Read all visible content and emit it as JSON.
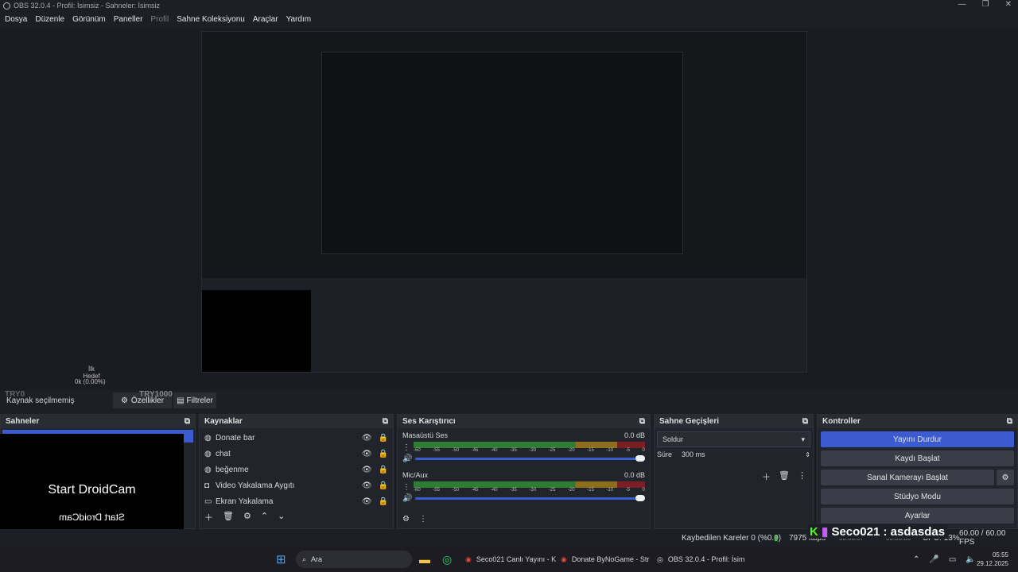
{
  "window": {
    "title": "OBS 32.0.4 - Profil: İsimsiz - Sahneler: İsimsiz"
  },
  "menu": {
    "items": [
      "Dosya",
      "Düzenle",
      "Görünüm",
      "Paneller",
      "Profil",
      "Sahne Koleksiyonu",
      "Araçlar",
      "Yardım"
    ]
  },
  "preview_left": {
    "ilk_hedef": "İlk Hedef",
    "ratio": "0k (0.00%)",
    "try0": "TRY0",
    "try1000": "TRY1000"
  },
  "source_bar": {
    "no_source": "Kaynak seçilmemiş",
    "properties": "Özellikler",
    "filters": "Filtreler"
  },
  "scenes": {
    "title": "Sahneler"
  },
  "phone": {
    "line1": "Start DroidCam",
    "line2": "Start DroidCam"
  },
  "sources": {
    "title": "Kaynaklar",
    "items": [
      {
        "label": "Donate bar"
      },
      {
        "label": "chat"
      },
      {
        "label": "beğenme"
      },
      {
        "label": "Video Yakalama Aygıtı"
      },
      {
        "label": "Ekran Yakalama"
      }
    ]
  },
  "mixer": {
    "title": "Ses Karıştırıcı",
    "channels": [
      {
        "name": "Masaüstü Ses",
        "db": "0.0 dB"
      },
      {
        "name": "Mic/Aux",
        "db": "0.0 dB"
      }
    ],
    "scale": [
      "-60",
      "-55",
      "-50",
      "-45",
      "-40",
      "-35",
      "-30",
      "-25",
      "-20",
      "-15",
      "-10",
      "-5",
      "0"
    ]
  },
  "transitions": {
    "title": "Sahne Geçişleri",
    "selected": "Soldur",
    "duration_label": "Süre",
    "duration": "300 ms"
  },
  "controls": {
    "title": "Kontroller",
    "buttons": [
      "Yayını Durdur",
      "Kaydı Başlat",
      "Sanal Kamerayı Başlat",
      "Stüdyo Modu",
      "Ayarlar"
    ]
  },
  "status": {
    "dropped": "Kaybedilen Kareler 0 (%0.0)",
    "kbps": "7975 kbps",
    "time1": "00:00:07",
    "time2": "00:00:00",
    "cpu": "CPU: 13%",
    "fps": "60.00 / 60.00 FPS",
    "overlay": "Seco021 : asdasdas"
  },
  "taskbar": {
    "search": "Ara",
    "apps": [
      "Seco021 Canlı Yayını - K",
      "Donate ByNoGame - Str",
      "OBS 32.0.4 - Profil: İsim"
    ],
    "clock": "05:55",
    "date": "29.12.2025"
  },
  "colors": {
    "accent": "#3c5bd1",
    "bg": "#1d1f26"
  }
}
